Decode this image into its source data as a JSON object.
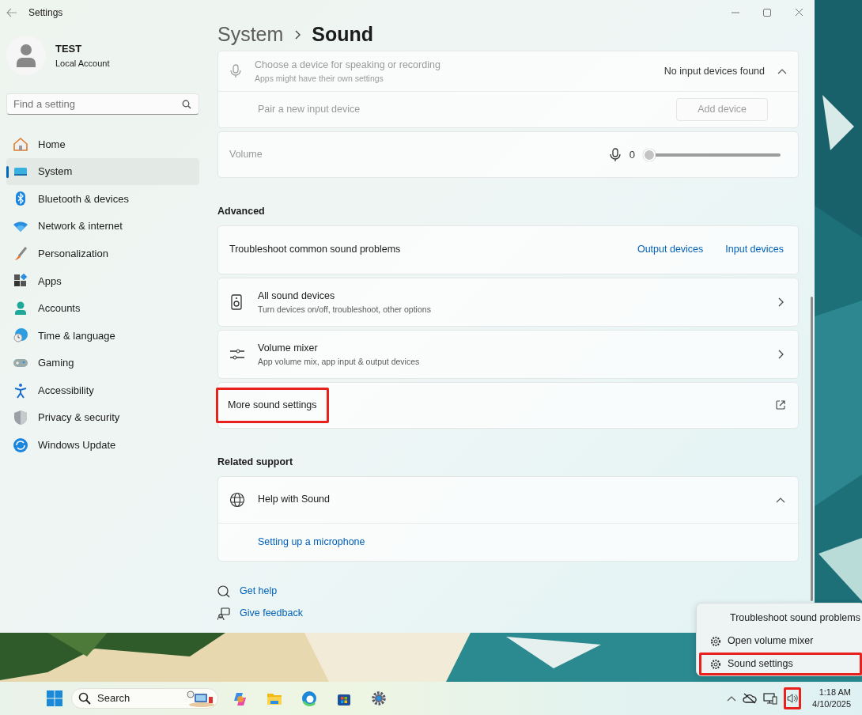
{
  "window": {
    "title": "Settings"
  },
  "profile": {
    "name": "TEST",
    "account": "Local Account"
  },
  "search": {
    "placeholder": "Find a setting"
  },
  "nav": [
    {
      "label": "Home",
      "selected": false
    },
    {
      "label": "System",
      "selected": true
    },
    {
      "label": "Bluetooth & devices",
      "selected": false
    },
    {
      "label": "Network & internet",
      "selected": false
    },
    {
      "label": "Personalization",
      "selected": false
    },
    {
      "label": "Apps",
      "selected": false
    },
    {
      "label": "Accounts",
      "selected": false
    },
    {
      "label": "Time & language",
      "selected": false
    },
    {
      "label": "Gaming",
      "selected": false
    },
    {
      "label": "Accessibility",
      "selected": false
    },
    {
      "label": "Privacy & security",
      "selected": false
    },
    {
      "label": "Windows Update",
      "selected": false
    }
  ],
  "breadcrumb": [
    "System",
    "Sound"
  ],
  "input_card": {
    "title": "Choose a device for speaking or recording",
    "subtitle": "Apps might have their own settings",
    "status": "No input devices found",
    "expanded": true,
    "disabled": true,
    "pair_label": "Pair a new input device",
    "button": "Add device"
  },
  "volume": {
    "label": "Volume",
    "reading": "0",
    "level": 0,
    "disabled": true
  },
  "sections": [
    {
      "heading": "Advanced",
      "rows": [
        {
          "kind": "links",
          "title": "Troubleshoot common sound problems",
          "links": [
            "Output devices",
            "Input devices"
          ]
        },
        {
          "kind": "nav",
          "title": "All sound devices",
          "subtitle": "Turn devices on/off, troubleshoot, other options"
        },
        {
          "kind": "nav",
          "title": "Volume mixer",
          "subtitle": "App volume mix, app input & output devices"
        },
        {
          "kind": "external",
          "title": "More sound settings",
          "highlighted": true
        }
      ]
    },
    {
      "heading": "Related support",
      "rows": [
        {
          "kind": "expander",
          "title": "Help with Sound",
          "expanded": true,
          "links": [
            "Setting up a microphone"
          ]
        }
      ]
    }
  ],
  "footer_links": [
    "Get help",
    "Give feedback"
  ],
  "context_menu": [
    {
      "label": "Troubleshoot sound problems",
      "kind": "plain",
      "highlighted": false
    },
    {
      "label": "Open volume mixer",
      "kind": "gear",
      "highlighted": false
    },
    {
      "label": "Sound settings",
      "kind": "gear",
      "highlighted": true
    }
  ],
  "taskbar": {
    "search_label": "Search",
    "time": "1:18 AM",
    "date": "4/10/2025",
    "volume_highlighted": true
  }
}
